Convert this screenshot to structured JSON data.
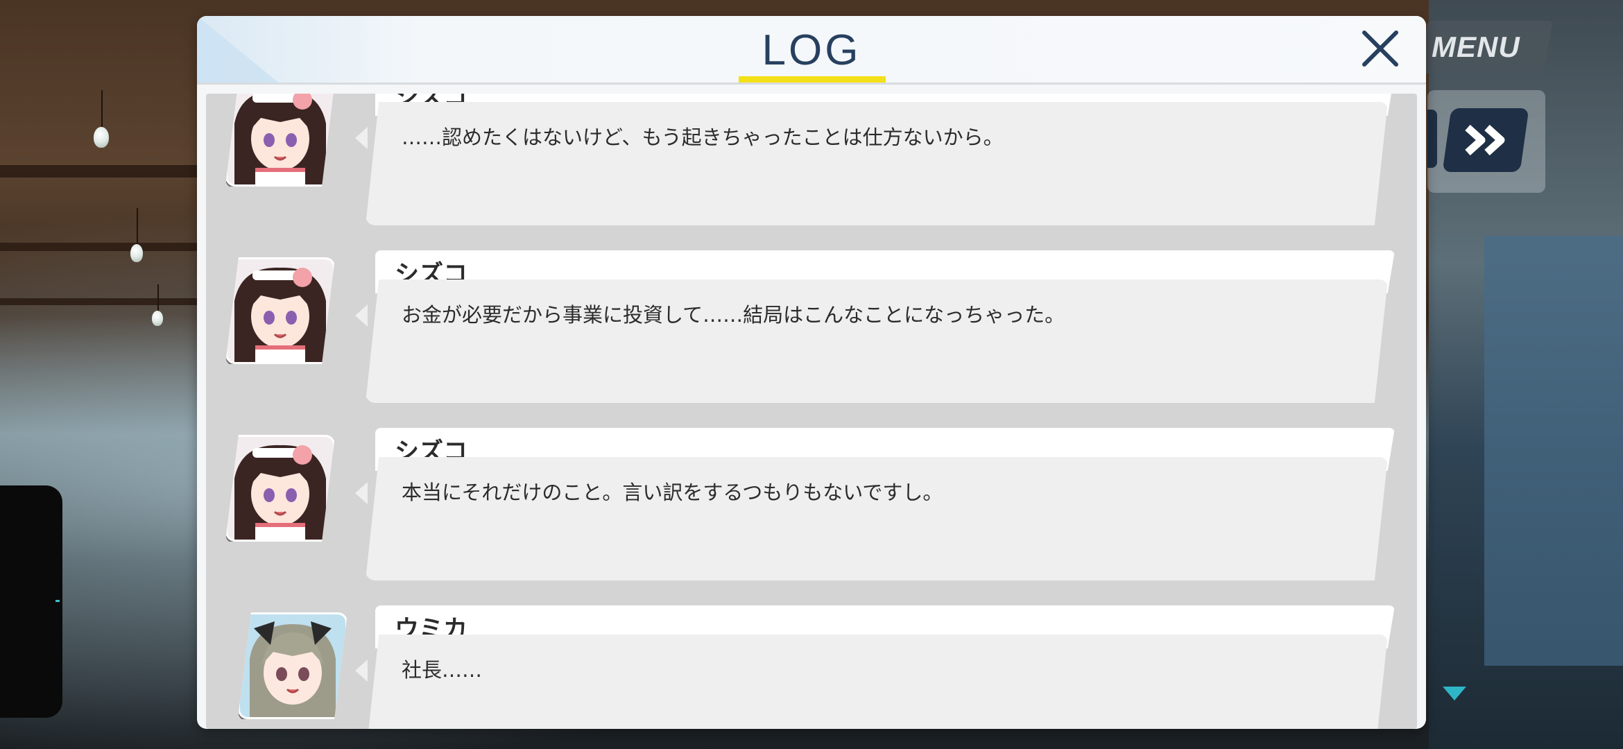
{
  "dialog": {
    "title": "LOG",
    "close_label": "close"
  },
  "side": {
    "menu_label": "MENU"
  },
  "log_entries": [
    {
      "speaker": "シズコ",
      "text": "……認めたくはないけど、もう起きちゃったことは仕方ないから。",
      "portrait": "shizuko"
    },
    {
      "speaker": "シズコ",
      "text": "お金が必要だから事業に投資して……結局はこんなことになっちゃった。",
      "portrait": "shizuko"
    },
    {
      "speaker": "シズコ",
      "text": "本当にそれだけのこと。言い訳をするつもりもないですし。",
      "portrait": "shizuko"
    },
    {
      "speaker": "ウミカ",
      "text": "社長……",
      "portrait": "umika"
    }
  ],
  "icons": {
    "close": "close-icon",
    "fast_forward": "fast-forward-icon",
    "scroll_down": "triangle-down-icon"
  },
  "colors": {
    "title": "#28405f",
    "title_underline": "#f4e017",
    "button_dark": "#1f2f45",
    "scroll_indicator": "#2fb6c6"
  }
}
